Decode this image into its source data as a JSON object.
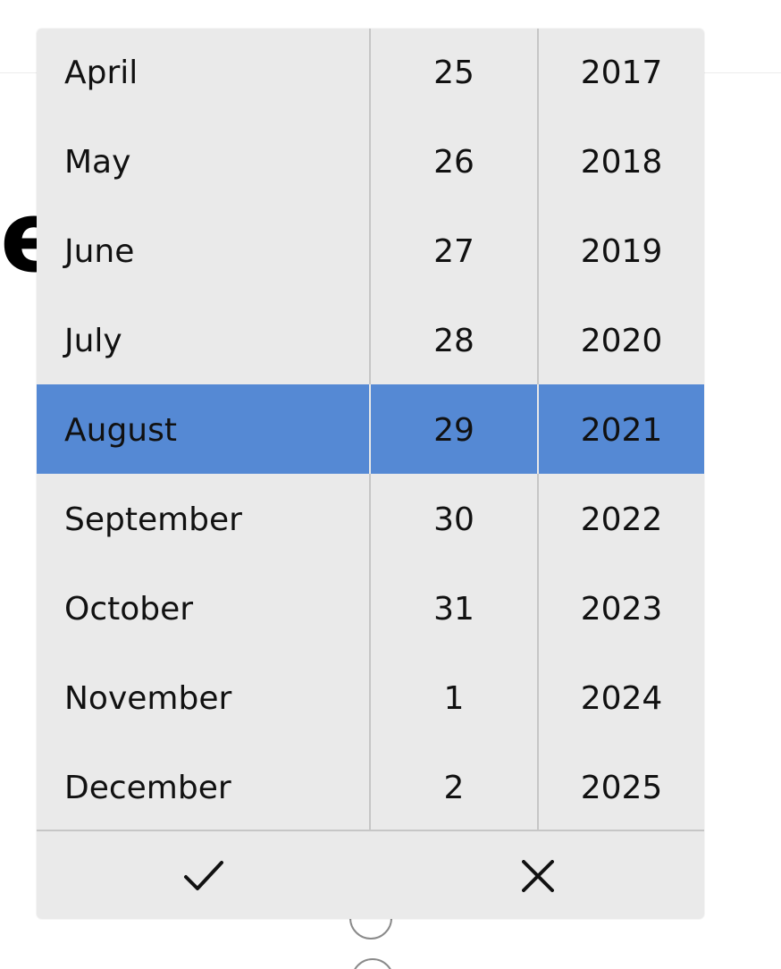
{
  "background": {
    "heading_fragment": "e"
  },
  "picker": {
    "months": [
      "April",
      "May",
      "June",
      "July",
      "August",
      "September",
      "October",
      "November",
      "December"
    ],
    "days": [
      "25",
      "26",
      "27",
      "28",
      "29",
      "30",
      "31",
      "1",
      "2"
    ],
    "years": [
      "2017",
      "2018",
      "2019",
      "2020",
      "2021",
      "2022",
      "2023",
      "2024",
      "2025"
    ],
    "selected": {
      "month": "August",
      "day": "29",
      "year": "2021"
    },
    "accept_icon": "checkmark-icon",
    "dismiss_icon": "close-icon"
  },
  "colors": {
    "selection": "#5589d4",
    "panel": "#eaeaea",
    "separator": "#c6c6c6",
    "text": "#111111"
  }
}
